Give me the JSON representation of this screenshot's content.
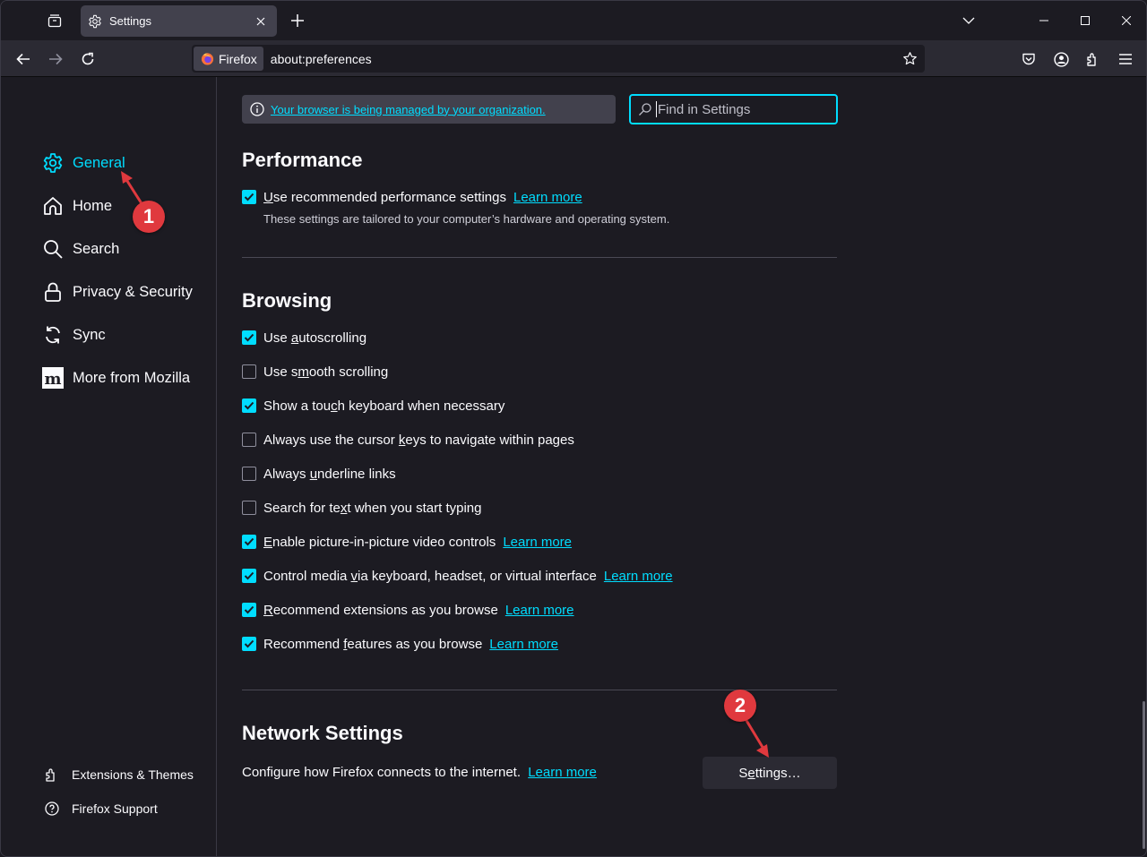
{
  "browser": {
    "tab": {
      "title": "Settings"
    },
    "identity_label": "Firefox",
    "url": "about:preferences"
  },
  "sidebar": {
    "categories": [
      {
        "label": "General",
        "icon": "gear-icon",
        "selected": true
      },
      {
        "label": "Home",
        "icon": "home-icon",
        "selected": false
      },
      {
        "label": "Search",
        "icon": "search-icon",
        "selected": false
      },
      {
        "label": "Privacy & Security",
        "icon": "lock-icon",
        "selected": false
      },
      {
        "label": "Sync",
        "icon": "sync-icon",
        "selected": false
      },
      {
        "label": "More from Mozilla",
        "icon": "mozilla-m-icon",
        "selected": false
      }
    ],
    "footer": [
      {
        "label": "Extensions & Themes",
        "icon": "puzzle-icon"
      },
      {
        "label": "Firefox Support",
        "icon": "help-icon"
      }
    ]
  },
  "main": {
    "policies_link": "Your browser is being managed by your organization.",
    "search": {
      "placeholder": "Find in Settings",
      "value": ""
    },
    "performance": {
      "title": "Performance",
      "option": {
        "label_pre": "",
        "accesskey": "U",
        "label_post": "se recommended performance settings",
        "checked": true,
        "learn_more": "Learn more"
      },
      "description": "These settings are tailored to your computer’s hardware and operating system."
    },
    "browsing": {
      "title": "Browsing",
      "options": [
        {
          "pre": "Use ",
          "key": "a",
          "post": "utoscrolling",
          "checked": true,
          "learn_more": ""
        },
        {
          "pre": "Use s",
          "key": "m",
          "post": "ooth scrolling",
          "checked": false,
          "learn_more": ""
        },
        {
          "pre": "Show a tou",
          "key": "c",
          "post": "h keyboard when necessary",
          "checked": true,
          "learn_more": ""
        },
        {
          "pre": "Always use the cursor ",
          "key": "k",
          "post": "eys to navigate within pages",
          "checked": false,
          "learn_more": ""
        },
        {
          "pre": "Always ",
          "key": "u",
          "post": "nderline links",
          "checked": false,
          "learn_more": ""
        },
        {
          "pre": "Search for te",
          "key": "x",
          "post": "t when you start typing",
          "checked": false,
          "learn_more": ""
        },
        {
          "pre": "",
          "key": "E",
          "post": "nable picture-in-picture video controls",
          "checked": true,
          "learn_more": "Learn more"
        },
        {
          "pre": "Control media ",
          "key": "v",
          "post": "ia keyboard, headset, or virtual interface",
          "checked": true,
          "learn_more": "Learn more"
        },
        {
          "pre": "",
          "key": "R",
          "post": "ecommend extensions as you browse",
          "checked": true,
          "learn_more": "Learn more"
        },
        {
          "pre": "Recommend ",
          "key": "f",
          "post": "eatures as you browse",
          "checked": true,
          "learn_more": "Learn more"
        }
      ]
    },
    "network": {
      "title": "Network Settings",
      "description": "Configure how Firefox connects to the internet.",
      "learn_more": "Learn more",
      "button": {
        "pre": "S",
        "key": "e",
        "post": "ttings…"
      }
    }
  },
  "annotations": [
    {
      "number": "1",
      "color": "#e0393e",
      "target": "General"
    },
    {
      "number": "2",
      "color": "#e0393e",
      "target": "Settings…"
    }
  ],
  "colors": {
    "accent": "#00ddff",
    "background": "#1c1b22",
    "annotation": "#e0393e"
  }
}
